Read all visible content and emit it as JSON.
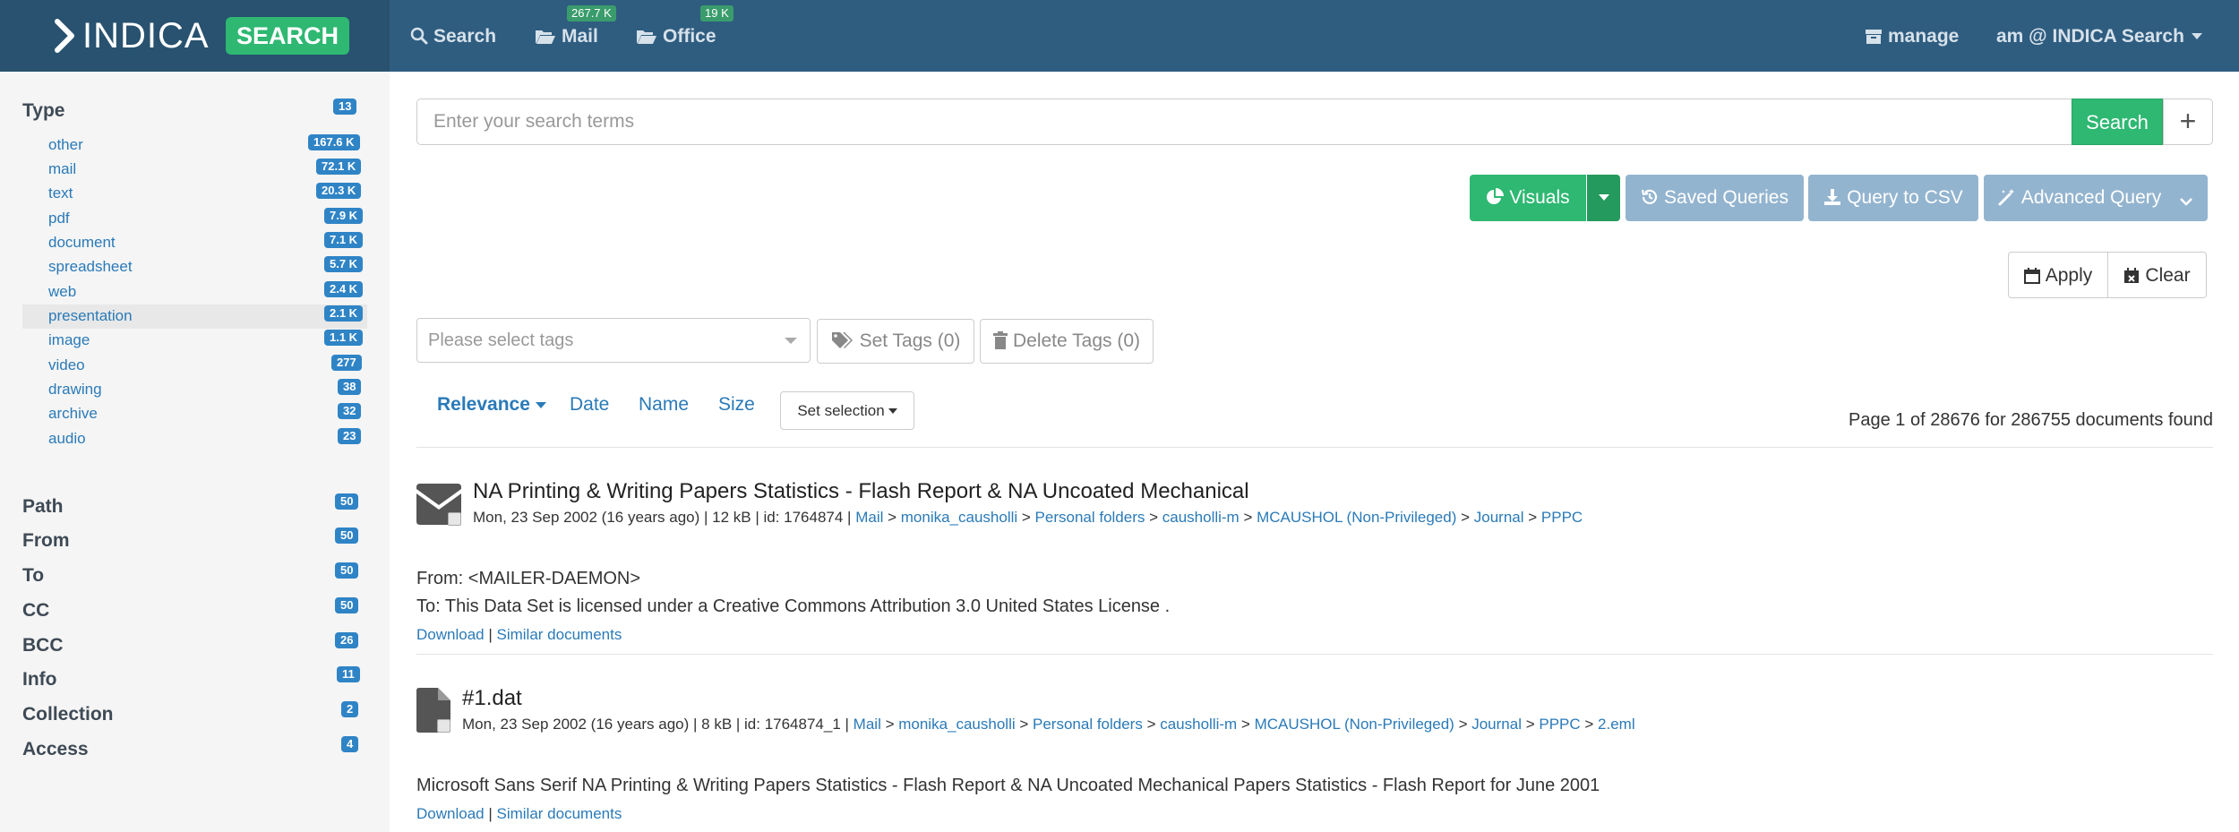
{
  "navbar": {
    "brand_text": "INDICA",
    "brand_badge": "SEARCH",
    "search_label": "Search",
    "mail_label": "Mail",
    "mail_count": "267.7 K",
    "office_label": "Office",
    "office_count": "19 K",
    "manage_label": "manage",
    "user_label": "am @ INDICA Search"
  },
  "sidebar": {
    "type": {
      "title": "Type",
      "count": "13",
      "items": [
        {
          "label": "other",
          "count": "167.6 K"
        },
        {
          "label": "mail",
          "count": "72.1 K"
        },
        {
          "label": "text",
          "count": "20.3 K"
        },
        {
          "label": "pdf",
          "count": "7.9 K"
        },
        {
          "label": "document",
          "count": "7.1 K"
        },
        {
          "label": "spreadsheet",
          "count": "5.7 K"
        },
        {
          "label": "web",
          "count": "2.4 K"
        },
        {
          "label": "presentation",
          "count": "2.1 K"
        },
        {
          "label": "image",
          "count": "1.1 K"
        },
        {
          "label": "video",
          "count": "277"
        },
        {
          "label": "drawing",
          "count": "38"
        },
        {
          "label": "archive",
          "count": "32"
        },
        {
          "label": "audio",
          "count": "23"
        }
      ]
    },
    "facets": [
      {
        "label": "Path",
        "count": "50"
      },
      {
        "label": "From",
        "count": "50"
      },
      {
        "label": "To",
        "count": "50"
      },
      {
        "label": "CC",
        "count": "50"
      },
      {
        "label": "BCC",
        "count": "26"
      },
      {
        "label": "Info",
        "count": "11"
      },
      {
        "label": "Collection",
        "count": "2"
      },
      {
        "label": "Access",
        "count": "4"
      }
    ]
  },
  "search": {
    "placeholder": "Enter your search terms",
    "button_label": "Search",
    "plus_label": "+"
  },
  "toolbar": {
    "visuals_label": "Visuals",
    "saved_queries_label": "Saved Queries",
    "query_csv_label": "Query to CSV",
    "advanced_query_label": "Advanced Query",
    "apply_label": "Apply",
    "clear_label": "Clear"
  },
  "tags": {
    "placeholder": "Please select tags",
    "set_tags_label": "Set Tags (0)",
    "delete_tags_label": "Delete Tags (0)"
  },
  "sort": {
    "relevance": "Relevance",
    "date": "Date",
    "name": "Name",
    "size": "Size",
    "set_selection": "Set selection"
  },
  "page_info": "Page 1 of 28676 for 286755 documents found",
  "results": [
    {
      "icon": "envelope-icon",
      "title": "NA Printing & Writing Papers Statistics - Flash Report & NA Uncoated Mechanical",
      "meta_prefix": "Mon, 23 Sep 2002 (16 years ago) | 12 kB | id: 1764874 |",
      "path": [
        "Mail",
        "monika_causholli",
        "Personal folders",
        "causholli-m",
        "MCAUSHOL (Non-Privileged)",
        "Journal",
        "PPPC"
      ],
      "line1": "From: <MAILER-DAEMON>",
      "line2": "To: This Data Set is licensed under a Creative Commons Attribution 3.0 United States License .",
      "download": "Download",
      "similar": "Similar documents",
      "link_sep": "|"
    },
    {
      "icon": "file-icon",
      "title": "#1.dat",
      "meta_prefix": "Mon, 23 Sep 2002 (16 years ago) | 8 kB | id: 1764874_1 |",
      "path": [
        "Mail",
        "monika_causholli",
        "Personal folders",
        "causholli-m",
        "MCAUSHOL (Non-Privileged)",
        "Journal",
        "PPPC",
        "2.eml"
      ],
      "line1": "Microsoft Sans Serif NA Printing & Writing Papers Statistics - Flash Report & NA Uncoated Mechanical Papers Statistics - Flash Report for June 2001",
      "download": "Download",
      "similar": "Similar documents",
      "link_sep": "|"
    }
  ],
  "colors": {
    "navbar": "#2f5d80",
    "brand_bg": "#28526f",
    "accent_green": "#2eb872",
    "link_blue": "#2a7ab8",
    "badge_blue": "#2f84c6"
  }
}
